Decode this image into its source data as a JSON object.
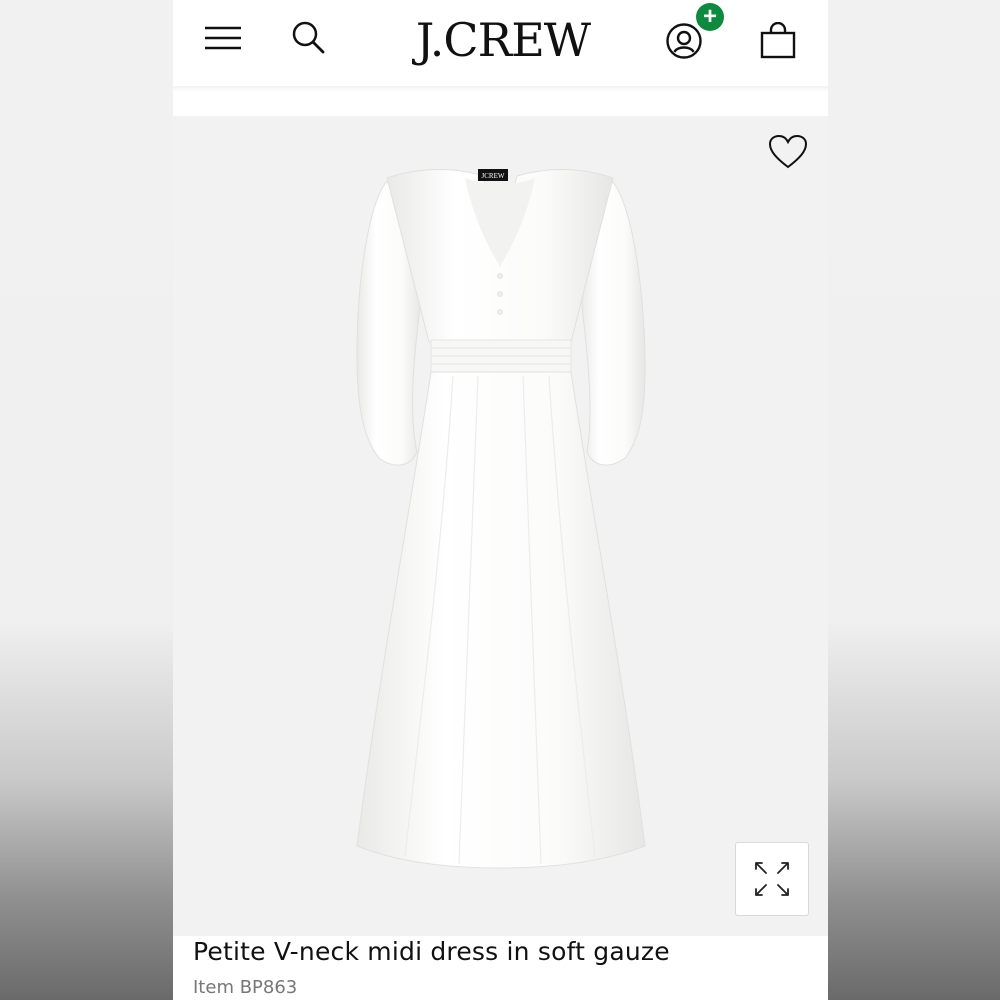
{
  "header": {
    "logo_text": "J.CREW",
    "menu_icon": "hamburger-menu-icon",
    "search_icon": "search-icon",
    "account_icon": "account-icon",
    "account_badge": "+",
    "bag_icon": "shopping-bag-icon"
  },
  "product": {
    "image_label": "JCREW",
    "title": "Petite V-neck midi dress in soft gauze",
    "item_number": "Item BP863",
    "favorite_icon": "heart-icon",
    "expand_icon": "expand-icon"
  },
  "colors": {
    "badge": "#0e8a3e",
    "text": "#111111",
    "subtext": "#777777",
    "image_bg": "#f2f2f2"
  }
}
